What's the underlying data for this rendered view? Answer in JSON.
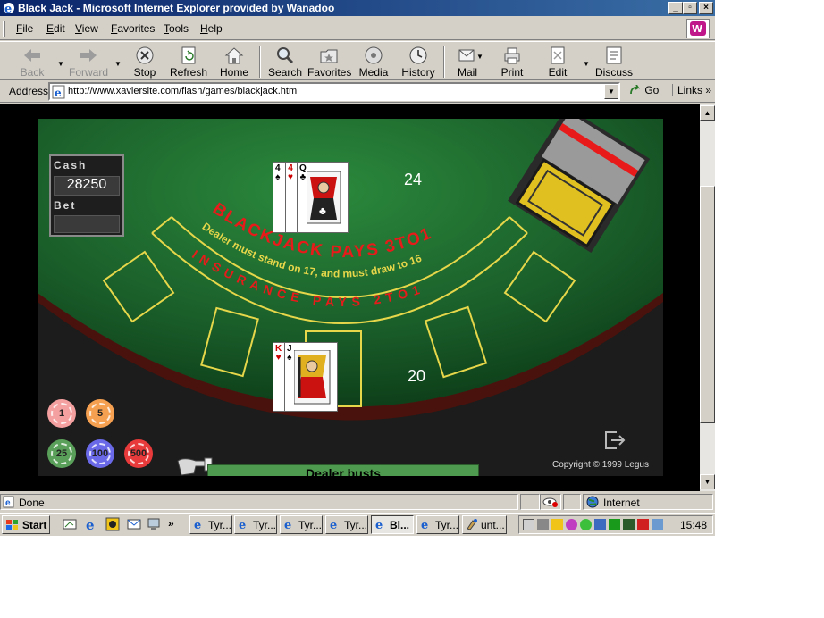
{
  "window": {
    "title": "Black Jack - Microsoft Internet Explorer provided by Wanadoo"
  },
  "menu": {
    "items": [
      {
        "label": "File",
        "key": "F",
        "rest": "ile"
      },
      {
        "label": "Edit",
        "key": "E",
        "rest": "dit"
      },
      {
        "label": "View",
        "key": "V",
        "rest": "iew"
      },
      {
        "label": "Favorites",
        "key": "F",
        "rest": "avorites"
      },
      {
        "label": "Tools",
        "key": "T",
        "rest": "ools"
      },
      {
        "label": "Help",
        "key": "H",
        "rest": "elp"
      }
    ]
  },
  "toolbar": {
    "back": "Back",
    "forward": "Forward",
    "stop": "Stop",
    "refresh": "Refresh",
    "home": "Home",
    "search": "Search",
    "favorites": "Favorites",
    "media": "Media",
    "history": "History",
    "mail": "Mail",
    "print": "Print",
    "edit": "Edit",
    "discuss": "Discuss"
  },
  "address": {
    "label": "Address",
    "url": "http://www.xaviersite.com/flash/games/blackjack.htm",
    "go": "Go",
    "links": "Links"
  },
  "status": {
    "text": "Done",
    "zone": "Internet"
  },
  "game": {
    "cash_label": "Cash",
    "cash_value": "28250",
    "bet_label": "Bet",
    "bet_value": "",
    "dealer_score": "24",
    "player_score": "20",
    "banner_main": "BLACKJACK  PAYS  3TO1",
    "banner_rule": "Dealer must stand on 17, and must draw to 16",
    "banner_insurance": "INSURANCE  PAYS  2TO1",
    "message": "Dealer busts",
    "copyright": "Copyright © 1999 Legus",
    "chips": [
      {
        "value": "1",
        "color": "#f5a0a0"
      },
      {
        "value": "5",
        "color": "#f5a050"
      },
      {
        "value": "25",
        "color": "#5aa05a"
      },
      {
        "value": "100",
        "color": "#6a6ae8"
      },
      {
        "value": "500",
        "color": "#e83a3a"
      }
    ],
    "dealer_cards": [
      {
        "rank": "4",
        "suit": "♠",
        "color": "#000"
      },
      {
        "rank": "4",
        "suit": "♥",
        "color": "#c00"
      },
      {
        "rank": "Q",
        "suit": "♣",
        "color": "#000"
      }
    ],
    "player_cards": [
      {
        "rank": "K",
        "suit": "♥",
        "color": "#c00"
      },
      {
        "rank": "J",
        "suit": "♠",
        "color": "#000"
      }
    ],
    "colors": {
      "felt": "#1f6e2f",
      "felt_dark": "#0e3d18",
      "rail": "#3a0d08",
      "lines": "#e6d64a",
      "banner_red": "#e81a1a"
    }
  },
  "taskbar": {
    "start": "Start",
    "tasks": [
      "Tyr...",
      "Tyr...",
      "Tyr...",
      "Tyr...",
      "Bl...",
      "Tyr...",
      "unt..."
    ],
    "clock": "15:48"
  }
}
